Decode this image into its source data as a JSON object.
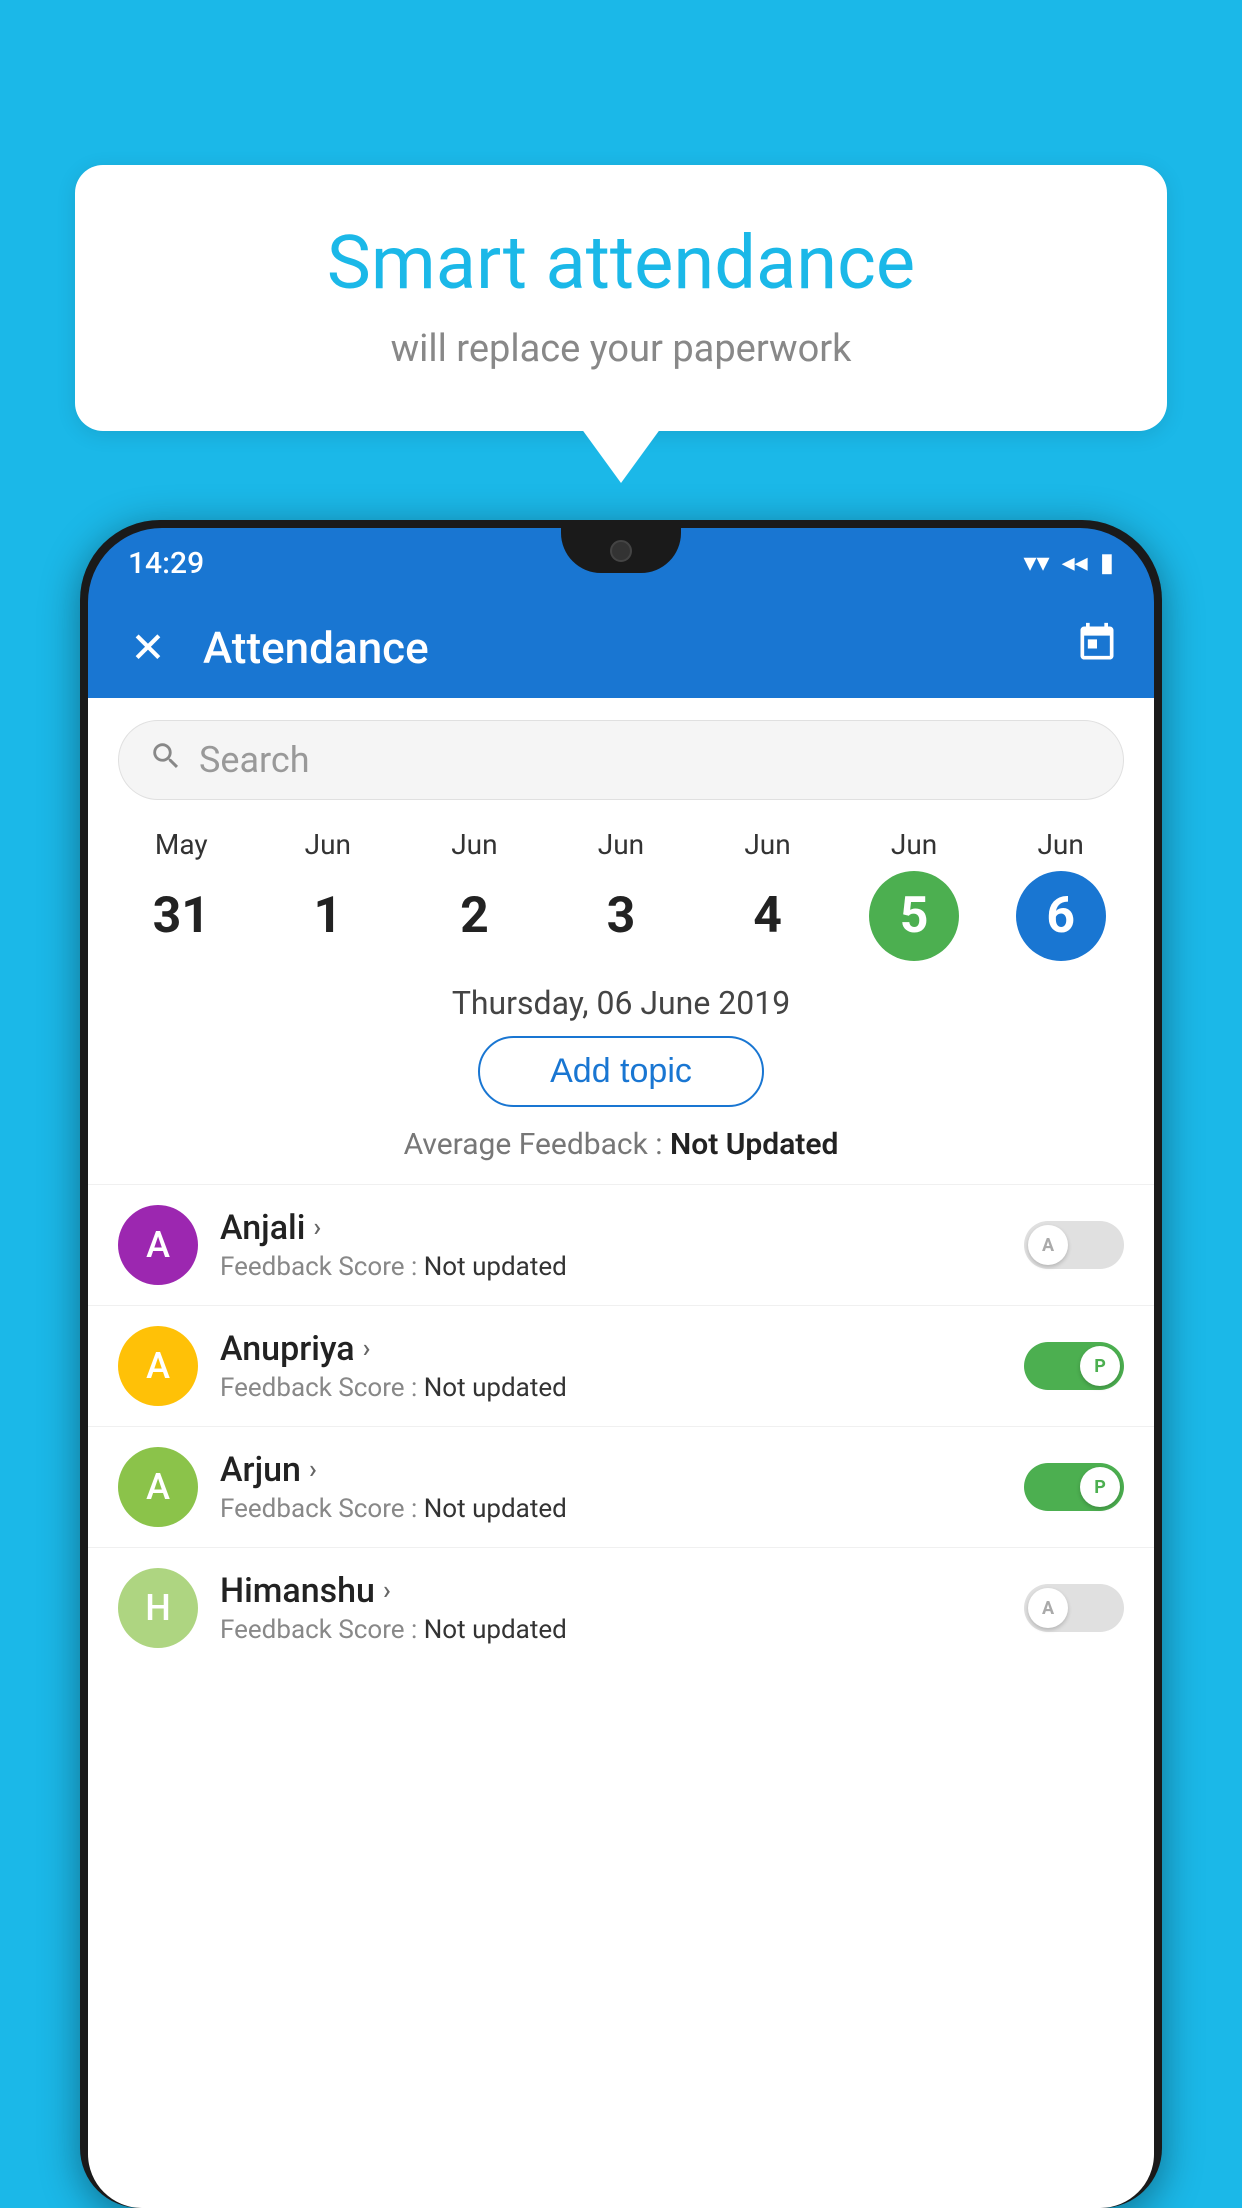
{
  "background_color": "#1BB8E8",
  "bubble": {
    "title": "Smart attendance",
    "subtitle": "will replace your paperwork"
  },
  "status_bar": {
    "time": "14:29",
    "wifi_icon": "▼",
    "signal_icon": "◂",
    "battery_icon": "▮"
  },
  "app_bar": {
    "close_icon": "✕",
    "title": "Attendance",
    "calendar_icon": "📅"
  },
  "search": {
    "placeholder": "Search"
  },
  "calendar": {
    "days": [
      {
        "month": "May",
        "date": "31",
        "style": "normal"
      },
      {
        "month": "Jun",
        "date": "1",
        "style": "normal"
      },
      {
        "month": "Jun",
        "date": "2",
        "style": "normal"
      },
      {
        "month": "Jun",
        "date": "3",
        "style": "normal"
      },
      {
        "month": "Jun",
        "date": "4",
        "style": "normal"
      },
      {
        "month": "Jun",
        "date": "5",
        "style": "today"
      },
      {
        "month": "Jun",
        "date": "6",
        "style": "selected"
      }
    ]
  },
  "selected_date": "Thursday, 06 June 2019",
  "add_topic_label": "Add topic",
  "average_feedback": {
    "label": "Average Feedback : ",
    "value": "Not Updated"
  },
  "students": [
    {
      "name": "Anjali",
      "avatar_letter": "A",
      "avatar_color": "#9C27B0",
      "feedback_label": "Feedback Score : ",
      "feedback_value": "Not updated",
      "toggle": "off",
      "toggle_letter": "A"
    },
    {
      "name": "Anupriya",
      "avatar_letter": "A",
      "avatar_color": "#FFC107",
      "feedback_label": "Feedback Score : ",
      "feedback_value": "Not updated",
      "toggle": "on",
      "toggle_letter": "P"
    },
    {
      "name": "Arjun",
      "avatar_letter": "A",
      "avatar_color": "#8BC34A",
      "feedback_label": "Feedback Score : ",
      "feedback_value": "Not updated",
      "toggle": "on",
      "toggle_letter": "P"
    },
    {
      "name": "Himanshu",
      "avatar_letter": "H",
      "avatar_color": "#AED581",
      "feedback_label": "Feedback Score : ",
      "feedback_value": "Not updated",
      "toggle": "off",
      "toggle_letter": "A"
    }
  ]
}
